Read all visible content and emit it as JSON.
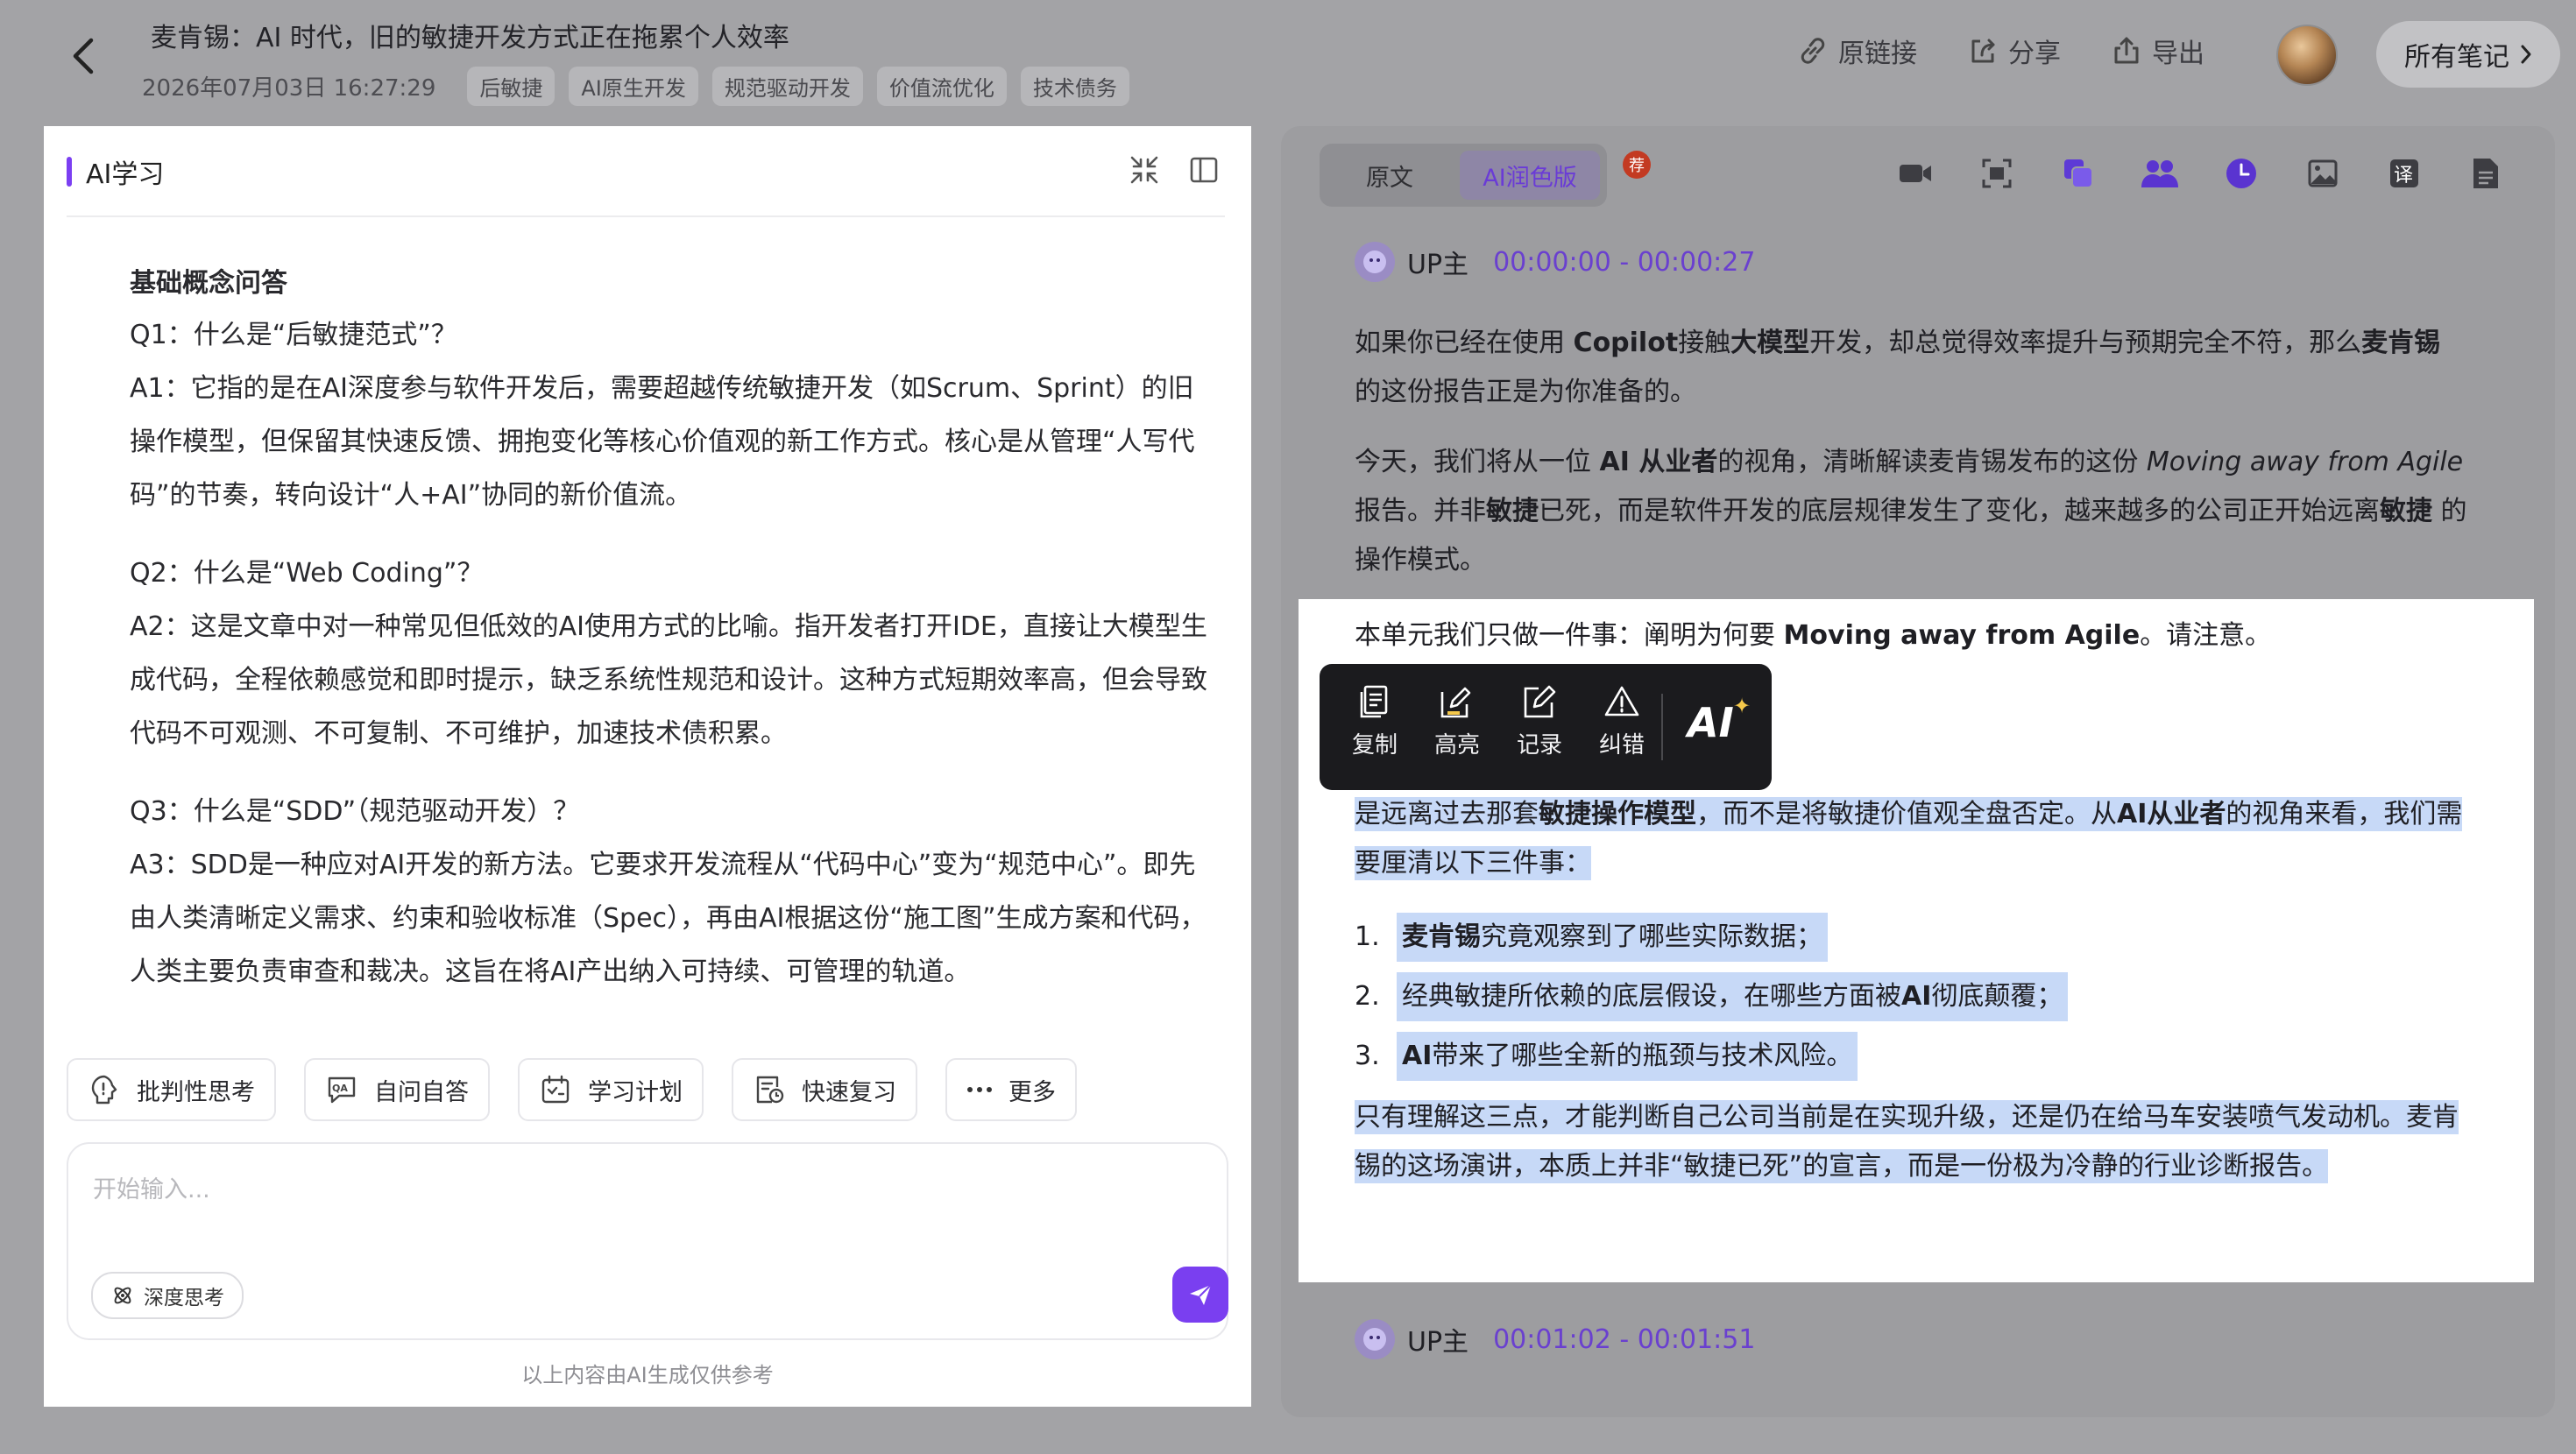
{
  "header": {
    "title": "麦肯锡：AI 时代，旧的敏捷开发方式正在拖累个人效率",
    "datetime": "2026年07月03日 16:27:29",
    "tags": [
      "后敏捷",
      "AI原生开发",
      "规范驱动开发",
      "价值流优化",
      "技术债务"
    ],
    "actions": {
      "original_link": "原链接",
      "share": "分享",
      "export": "导出"
    },
    "all_notes": "所有笔记"
  },
  "left_panel": {
    "title": "AI学习",
    "section_title": "基础概念问答",
    "qa": [
      {
        "q": "Q1：什么是“后敏捷范式”？",
        "a": "A1：它指的是在AI深度参与软件开发后，需要超越传统敏捷开发（如Scrum、Sprint）的旧操作模型，但保留其快速反馈、拥抱变化等核心价值观的新工作方式。核心是从管理“人写代码”的节奏，转向设计“人+AI”协同的新价值流。"
      },
      {
        "q": "Q2：什么是“Web Coding”？",
        "a": "A2：这是文章中对一种常见但低效的AI使用方式的比喻。指开发者打开IDE，直接让大模型生成代码，全程依赖感觉和即时提示，缺乏系统性规范和设计。这种方式短期效率高，但会导致代码不可观测、不可复制、不可维护，加速技术债积累。"
      },
      {
        "q": "Q3：什么是“SDD”（规范驱动开发）？",
        "a": "A3：SDD是一种应对AI开发的新方法。它要求开发流程从“代码中心”变为“规范中心”。即先由人类清晰定义需求、约束和验收标准（Spec），再由AI根据这份“施工图”生成方案和代码，人类主要负责审查和裁决。这旨在将AI产出纳入可持续、可管理的轨道。"
      }
    ],
    "chips": [
      "批判性思考",
      "自问自答",
      "学习计划",
      "快速复习",
      "更多"
    ],
    "input_placeholder": "开始输入...",
    "deep_think": "深度思考",
    "disclaimer": "以上内容由AI生成仅供参考"
  },
  "right_panel": {
    "tabs": [
      "原文",
      "AI润色版"
    ],
    "badge": "荐",
    "speaker1": {
      "name": "UP主",
      "time": "00:00:00 - 00:00:27"
    },
    "para1": {
      "t1": "如果你已经在使用 ",
      "b1": "Copilot",
      "t2": "接触",
      "b2": "大模型",
      "t3": "开发，却总觉得效率提升与预期完全不符，那么",
      "b3": "麦肯锡",
      "t4": " 的这份报告正是为你准备的。"
    },
    "para2": {
      "t1": "今天，我们将从一位 ",
      "b1": "AI 从业者",
      "t2": "的视角，清晰解读麦肯锡发布的这份 ",
      "i1": "Moving away from Agile",
      "t3": " 报告。并非",
      "b2": "敏捷",
      "t4": "已死，而是软件开发的底层规律发生了变化，越来越多的公司正开始远离",
      "b3": "敏捷",
      "t5": " 的操作模式。"
    },
    "card": {
      "first": {
        "t1": "本单元我们只做一件事：阐明为何要 ",
        "b1": "Moving away from Agile",
        "t2": "。请注意。"
      },
      "p2": {
        "t1": "是远离过去那套",
        "b1": "敏捷操作模型",
        "t2": "，而不是将敏捷价值观全盘否定。从",
        "b2": "AI从业者",
        "t3": "的视角来看，我们需要厘清以下三件事："
      },
      "list": [
        {
          "num": "1.",
          "b": "麦肯锡",
          "t": "究竟观察到了哪些实际数据；"
        },
        {
          "num": "2.",
          "t1": "经典敏捷所依赖的底层假设，在哪些方面被",
          "b": "AI",
          "t2": "彻底颠覆；"
        },
        {
          "num": "3.",
          "b": "AI",
          "t": "带来了哪些全新的瓶颈与技术风险。"
        }
      ],
      "p3": "只有理解这三点，才能判断自己公司当前是在实现升级，还是仍在给马车安装喷气发动机。麦肯锡的这场演讲，本质上并非“敏捷已死”的宣言，而是一份极为冷静的行业诊断报告。"
    },
    "popup": {
      "items": [
        "复制",
        "高亮",
        "记录",
        "纠错"
      ],
      "ai": "AI"
    },
    "speaker2": {
      "name": "UP主",
      "time": "00:01:02 - 00:01:51"
    }
  },
  "colors": {
    "accent": "#7a3ff0",
    "timestamp": "#6a40cf",
    "highlight": "#c7d9f7",
    "popup_bg": "#1b1b1e"
  }
}
